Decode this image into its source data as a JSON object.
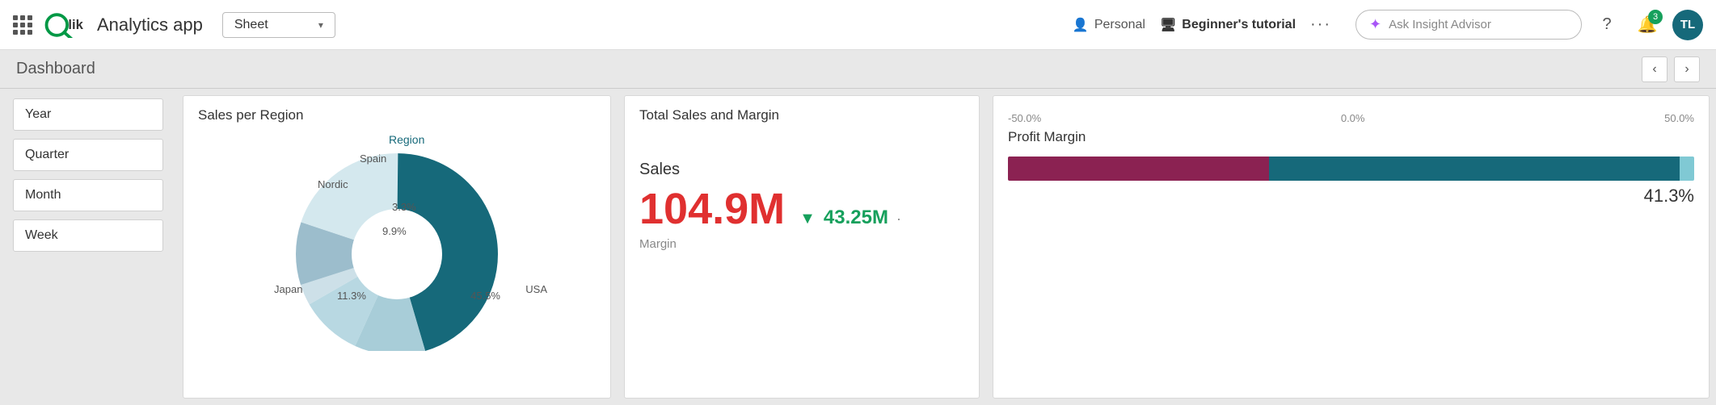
{
  "app": {
    "title": "Analytics app",
    "logo_text": "Qlik"
  },
  "topnav": {
    "sheet_label": "Sheet",
    "personal_label": "Personal",
    "tutorial_label": "Beginner's tutorial",
    "more_dots": "···",
    "insight_placeholder": "Ask Insight Advisor",
    "help_icon": "?",
    "notif_count": "3",
    "avatar_initials": "TL"
  },
  "dashboard": {
    "title": "Dashboard",
    "prev_icon": "‹",
    "next_icon": "›"
  },
  "sidebar": {
    "filters": [
      {
        "label": "Year"
      },
      {
        "label": "Quarter"
      },
      {
        "label": "Month"
      },
      {
        "label": "Week"
      }
    ]
  },
  "sales_region": {
    "title": "Sales per Region",
    "legend_label": "Region",
    "segments": [
      {
        "label": "USA",
        "pct": "45.5%",
        "color": "#16697a",
        "value": 45.5
      },
      {
        "label": "Japan",
        "pct": "11.3%",
        "color": "#a8cdd8",
        "value": 11.3
      },
      {
        "label": "",
        "pct": "9.9%",
        "color": "#b8d8e2",
        "value": 9.9
      },
      {
        "label": "",
        "pct": "3.3%",
        "color": "#cde0e8",
        "value": 3.3
      },
      {
        "label": "Nordic",
        "pct": "",
        "color": "#9cbdcc",
        "value": 10.0
      },
      {
        "label": "Spain",
        "pct": "",
        "color": "#d4e8ee",
        "value": 20.0
      }
    ]
  },
  "total_sales": {
    "title": "Total Sales and Margin",
    "sales_label": "Sales",
    "sales_value": "104.9M",
    "arrow": "▼",
    "margin_value": "43.25M",
    "margin_dot": "·",
    "margin_label": "Margin"
  },
  "profit_margin": {
    "title": "Profit Margin",
    "axis_left": "-50.0%",
    "axis_center": "0.0%",
    "axis_right": "50.0%",
    "percentage": "41.3%"
  }
}
